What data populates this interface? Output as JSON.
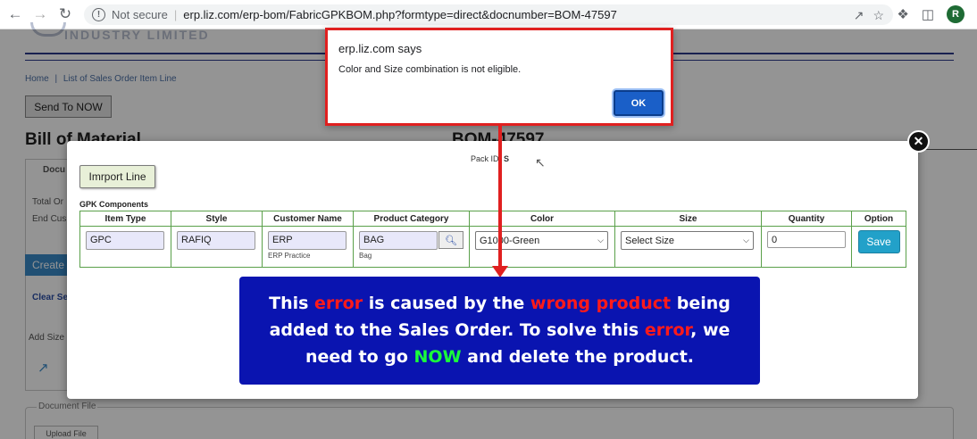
{
  "browser": {
    "security_label": "Not secure",
    "url": "erp.liz.com/erp-bom/FabricGPKBOM.php?formtype=direct&docnumber=BOM-47597",
    "avatar_letter": "R"
  },
  "page": {
    "company_name": "INDUSTRY LIMITED",
    "breadcrumb_home": "Home",
    "breadcrumb_sep": "|",
    "breadcrumb_current": "List of Sales Order Item Line",
    "send_button": "Send To NOW",
    "title": "Bill of Material",
    "doc_number": "BOM-47597",
    "doc_legend": "Docu",
    "total_label": "Total Or",
    "end_cust_label": "End Cus",
    "create_button": "Create",
    "clear_label": "Clear Se",
    "add_size_label": "Add Size",
    "document_file_legend": "Document File",
    "upload_button": "Upload File"
  },
  "modal": {
    "pack_label": "Pack ID:",
    "pack_value": "S",
    "import_button": "Imrport Line",
    "section_label": "GPK Components",
    "columns": [
      "Item Type",
      "Style",
      "Customer Name",
      "Product Category",
      "Color",
      "Size",
      "Quantity",
      "Option"
    ],
    "row": {
      "item_type": "GPC",
      "style": "RAFIQ",
      "customer_name": "ERP",
      "customer_sub": "ERP Practice",
      "product_category": "BAG",
      "product_sub": "Bag",
      "color": "G1000-Green",
      "size": "Select Size",
      "quantity": "0",
      "save_button": "Save"
    }
  },
  "alert": {
    "title": "erp.liz.com says",
    "message": "Color and Size combination is not eligible.",
    "ok_button": "OK"
  },
  "annotation": {
    "t1": "This ",
    "t2": "error",
    "t3": " is caused by the ",
    "t4": "wrong product",
    "t5": " being",
    "t6": "added to the Sales Order. To solve this ",
    "t7": "error",
    "t8": ", we",
    "t9": "need to go ",
    "t10": "NOW",
    "t11": " and delete the product."
  },
  "colors": {
    "alert_border": "#e02020",
    "callout_bg": "#0a14b0",
    "highlight_red": "#ff1a1a",
    "highlight_green": "#1aff3a",
    "save_button": "#22a1c9"
  }
}
